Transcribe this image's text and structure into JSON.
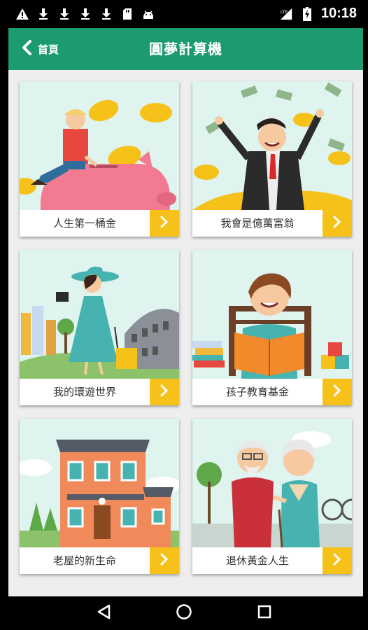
{
  "status_bar": {
    "time": "10:18",
    "left_icons": [
      "warning-icon",
      "download-icon",
      "download-icon",
      "download-icon",
      "download-icon",
      "sd-card-icon",
      "android-icon"
    ],
    "right_icons": [
      "signal-lte-icon",
      "battery-charging-icon"
    ]
  },
  "header": {
    "back_label": "首頁",
    "title": "圓夢計算機"
  },
  "cards": [
    {
      "label": "人生第一桶金"
    },
    {
      "label": "我會是億萬富翁"
    },
    {
      "label": "我的環遊世界"
    },
    {
      "label": "孩子教育基金"
    },
    {
      "label": "老屋的新生命"
    },
    {
      "label": "退休黃金人生"
    }
  ],
  "nav": {
    "icons": [
      "back-triangle-icon",
      "home-circle-icon",
      "recents-square-icon"
    ]
  },
  "colors": {
    "primary": "#1d9b70",
    "accent": "#f6c21a",
    "card_bg": "#dff3ef",
    "page_bg": "#eeeeee"
  }
}
